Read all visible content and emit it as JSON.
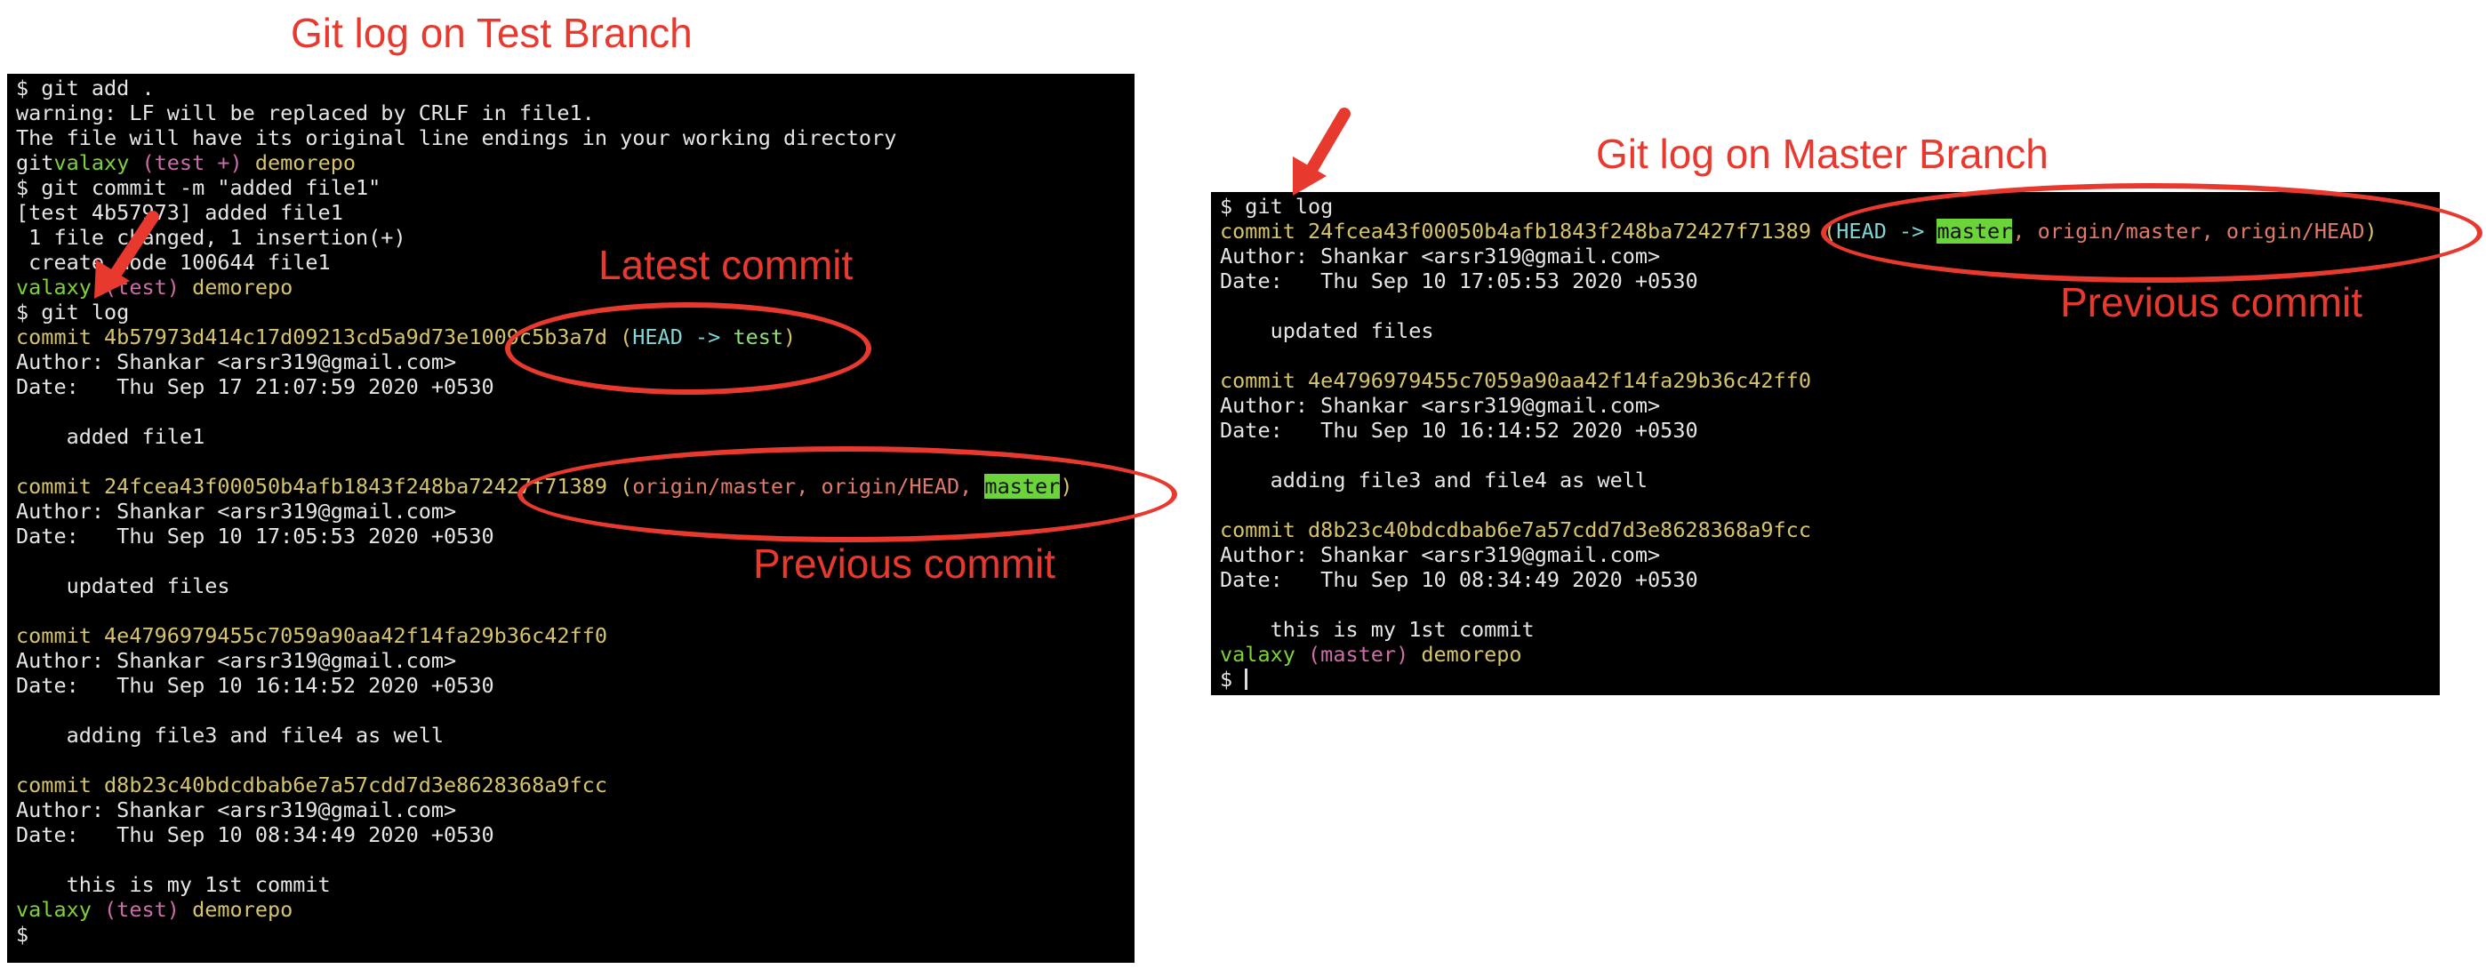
{
  "headings": {
    "left": "Git log on Test Branch",
    "right": "Git log on Master Branch"
  },
  "annotations": {
    "latest_commit": "Latest commit",
    "previous_commit_left": "Previous commit",
    "previous_commit_right": "Previous commit"
  },
  "accent_color": "#e8392f",
  "left_terminal": {
    "l1": "$ git add .",
    "l2": "warning: LF will be replaced by CRLF in file1.",
    "l3": "The file will have its original line endings in your working directory",
    "l4_a": "git",
    "l4_b": "valaxy",
    "l4_c": " (test +) ",
    "l4_d": "demorepo",
    "l5": "$ git commit -m \"added file1\"",
    "l6": "[test 4b57973] added file1",
    "l7": " 1 file changed, 1 insertion(+)",
    "l8": " create mode 100644 file1",
    "l9_a": "valaxy",
    "l9_b": " (test) ",
    "l9_c": "demorepo",
    "l10": "$ git log",
    "c1_hash": "commit 4b57973d414c17d09213cd5a9d73e1009c5b3a7d",
    "c1_ref_open": " (",
    "c1_ref_head": "HEAD -> ",
    "c1_ref_branch": "test",
    "c1_ref_close": ")",
    "c1_author": "Author: Shankar <arsr319@gmail.com>",
    "c1_date": "Date:   Thu Sep 17 21:07:59 2020 +0530",
    "c1_msg": "    added file1",
    "c2_hash": "commit 24fcea43f00050b4afb1843f248ba72427f71389",
    "c2_ref_open": " (",
    "c2_ref_remotes": "origin/master, origin/HEAD, ",
    "c2_ref_master": "master",
    "c2_ref_close": ")",
    "c2_author": "Author: Shankar <arsr319@gmail.com>",
    "c2_date": "Date:   Thu Sep 10 17:05:53 2020 +0530",
    "c2_msg": "    updated files",
    "c3_hash": "commit 4e4796979455c7059a90aa42f14fa29b36c42ff0",
    "c3_author": "Author: Shankar <arsr319@gmail.com>",
    "c3_date": "Date:   Thu Sep 10 16:14:52 2020 +0530",
    "c3_msg": "    adding file3 and file4 as well",
    "c4_hash": "commit d8b23c40bdcdbab6e7a57cdd7d3e8628368a9fcc",
    "c4_author": "Author: Shankar <arsr319@gmail.com>",
    "c4_date": "Date:   Thu Sep 10 08:34:49 2020 +0530",
    "c4_msg": "    this is my 1st commit",
    "p_a": "valaxy",
    "p_b": " (test) ",
    "p_c": "demorepo",
    "prompt": "$"
  },
  "right_terminal": {
    "l1": "$ git log",
    "c1_hash": "commit 24fcea43f00050b4afb1843f248ba72427f71389",
    "c1_ref_open": " (",
    "c1_ref_head": "HEAD -> ",
    "c1_ref_master": "master",
    "c1_ref_remotes": ", origin/master, origin/HEAD",
    "c1_ref_close": ")",
    "c1_author": "Author: Shankar <arsr319@gmail.com>",
    "c1_date": "Date:   Thu Sep 10 17:05:53 2020 +0530",
    "c1_msg": "    updated files",
    "c2_hash": "commit 4e4796979455c7059a90aa42f14fa29b36c42ff0",
    "c2_author": "Author: Shankar <arsr319@gmail.com>",
    "c2_date": "Date:   Thu Sep 10 16:14:52 2020 +0530",
    "c2_msg": "    adding file3 and file4 as well",
    "c3_hash": "commit d8b23c40bdcdbab6e7a57cdd7d3e8628368a9fcc",
    "c3_author": "Author: Shankar <arsr319@gmail.com>",
    "c3_date": "Date:   Thu Sep 10 08:34:49 2020 +0530",
    "c3_msg": "    this is my 1st commit",
    "p_a": "valaxy",
    "p_b": " (master) ",
    "p_c": "demorepo",
    "prompt": "$ "
  }
}
